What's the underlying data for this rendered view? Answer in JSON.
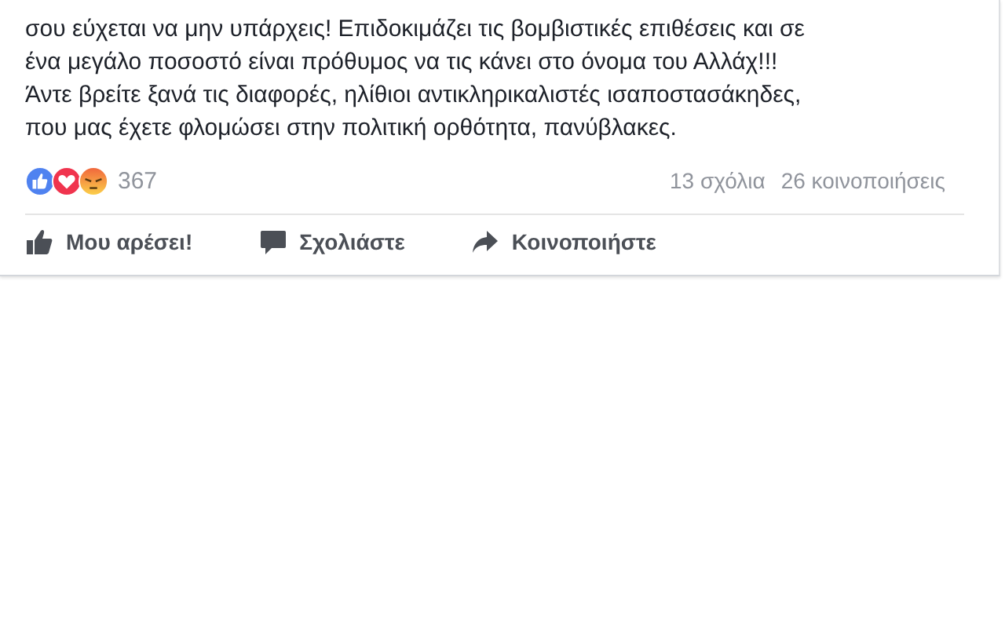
{
  "post": {
    "text_lines": [
      "σου εύχεται να μην υπάρχεις! Επιδοκιμάζει τις βομβιστικές επιθέσεις και σε",
      "ένα μεγάλο ποσοστό είναι πρόθυμος να τις κάνει στο όνομα του Αλλάχ!!!",
      "Άντε βρείτε ξανά τις διαφορές, ηλίθιοι αντικληρικαλιστές ισαποστασάκηδες,",
      "που μας έχετε φλομώσει στην πολιτική ορθότητα, πανύβλακες."
    ],
    "reaction_count": "367",
    "comments": "13 σχόλια",
    "shares": "26 κοινοποιήσεις",
    "actions": [
      {
        "kind": "like",
        "label": "Μου αρέσει!"
      },
      {
        "kind": "comment",
        "label": "Σχολιάστε"
      },
      {
        "kind": "share",
        "label": "Κοινοποιήστε"
      }
    ]
  }
}
